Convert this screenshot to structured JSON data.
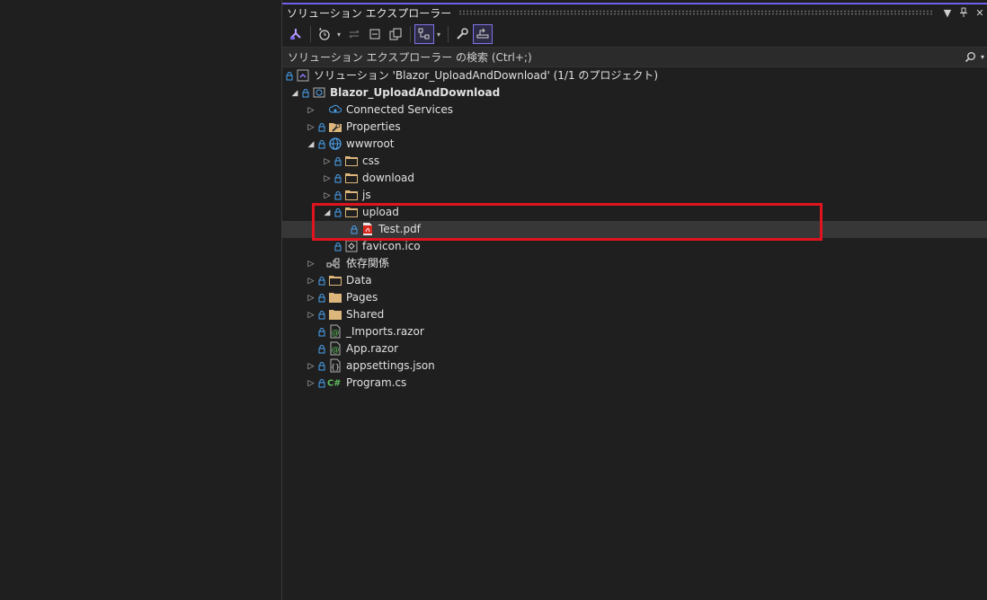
{
  "panel": {
    "title": "ソリューション エクスプローラー",
    "controls": {
      "dropdown_icon": "▼",
      "pin_icon": "pin",
      "close_icon": "✕"
    }
  },
  "toolbar": {
    "buttons": [
      {
        "name": "switch-views-button",
        "icon": "vs-switch-icon"
      },
      {
        "name": "pending-changes-filter-button",
        "icon": "clock-icon"
      },
      {
        "name": "sync-with-active-document-button",
        "icon": "sync-icon"
      },
      {
        "name": "collapse-all-button",
        "icon": "collapse-icon"
      },
      {
        "name": "show-all-files-button",
        "icon": "copy-icon"
      },
      {
        "name": "toggle-hierarchy-button",
        "icon": "hierarchy-icon"
      },
      {
        "name": "properties-button",
        "icon": "wrench-icon"
      },
      {
        "name": "preview-selected-items-button",
        "icon": "preview-icon"
      }
    ]
  },
  "search": {
    "placeholder": "ソリューション エクスプローラー の検索 (Ctrl+;)"
  },
  "tree": {
    "solution": "ソリューション 'Blazor_UploadAndDownload' (1/1 のプロジェクト)",
    "project": "Blazor_UploadAndDownload",
    "items": {
      "connected_services": "Connected Services",
      "properties": "Properties",
      "wwwroot": "wwwroot",
      "css": "css",
      "download": "download",
      "js": "js",
      "upload": "upload",
      "test_pdf": "Test.pdf",
      "favicon": "favicon.ico",
      "dependencies": "依存関係",
      "data": "Data",
      "pages": "Pages",
      "shared": "Shared",
      "imports": "_Imports.razor",
      "app": "App.razor",
      "appsettings": "appsettings.json",
      "program": "Program.cs"
    }
  },
  "colors": {
    "accent": "#7160e8",
    "highlight_box": "#e0141e",
    "folder": "#dcb67a",
    "lock": "#4aa3f0"
  }
}
